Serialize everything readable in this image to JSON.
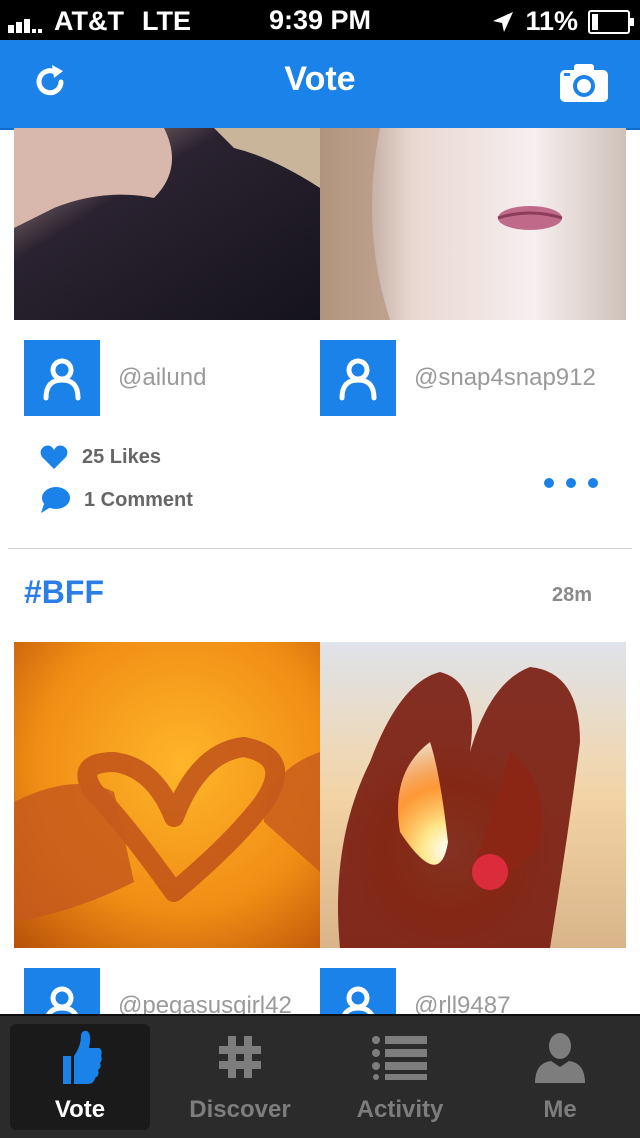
{
  "status_bar": {
    "carrier": "AT&T",
    "network": "LTE",
    "time": "9:39 PM",
    "battery_percent": "11%"
  },
  "navbar": {
    "title": "Vote",
    "left_icon": "refresh-icon",
    "right_icon": "camera-icon"
  },
  "post1": {
    "users": [
      {
        "handle": "@ailund"
      },
      {
        "handle": "@snap4snap912"
      }
    ],
    "likes": "25 Likes",
    "comments": "1 Comment"
  },
  "post2": {
    "hashtag": "#BFF",
    "time_ago": "28m",
    "users": [
      {
        "handle": "@pegasusgirl42"
      },
      {
        "handle": "@rll9487"
      }
    ]
  },
  "tabs": [
    {
      "label": "Vote",
      "icon": "thumbs-up-icon",
      "active": true
    },
    {
      "label": "Discover",
      "icon": "hashtag-icon",
      "active": false
    },
    {
      "label": "Activity",
      "icon": "list-icon",
      "active": false
    },
    {
      "label": "Me",
      "icon": "person-icon",
      "active": false
    }
  ],
  "colors": {
    "accent": "#1a82e8",
    "tabbar": "#2b2b2b"
  }
}
